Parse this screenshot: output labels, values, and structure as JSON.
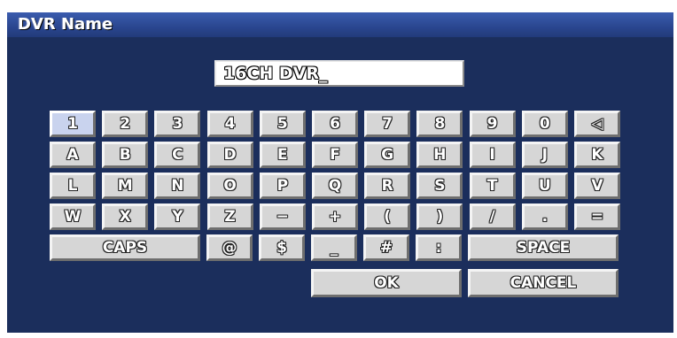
{
  "dialog": {
    "title": "DVR Name",
    "name_value": "16CH DVR_"
  },
  "keyboard": {
    "row1": [
      "1",
      "2",
      "3",
      "4",
      "5",
      "6",
      "7",
      "8",
      "9",
      "0",
      "◁"
    ],
    "row2": [
      "A",
      "B",
      "C",
      "D",
      "E",
      "F",
      "G",
      "H",
      "I",
      "J",
      "K"
    ],
    "row3": [
      "L",
      "M",
      "N",
      "O",
      "P",
      "Q",
      "R",
      "S",
      "T",
      "U",
      "V"
    ],
    "row4": [
      "W",
      "X",
      "Y",
      "Z",
      "−",
      "+",
      "(",
      ")",
      "/",
      ".",
      "="
    ],
    "row5": {
      "caps": "CAPS",
      "sym1": "@",
      "sym2": "$",
      "sym3": "_",
      "sym4": "#",
      "sym5": ":",
      "space": "SPACE"
    },
    "row6": {
      "ok": "OK",
      "cancel": "CANCEL"
    },
    "selected_key": "1"
  }
}
